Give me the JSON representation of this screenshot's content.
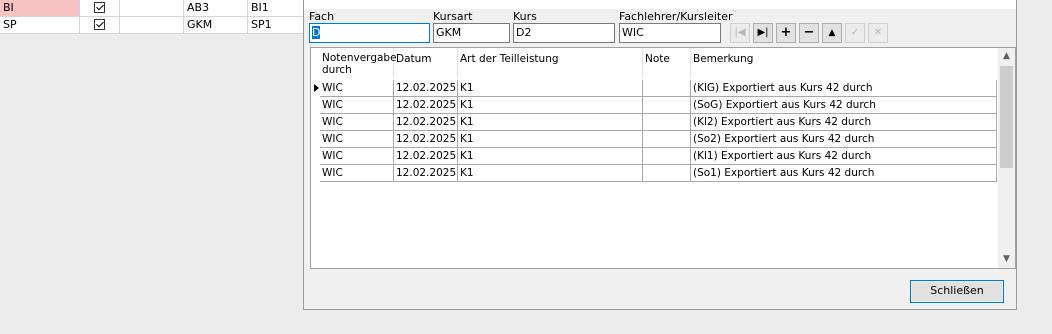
{
  "background_grid": {
    "rows": [
      {
        "fach": "BI",
        "checked": true,
        "col3": "",
        "kursart": "AB3",
        "kurs": "BI1"
      },
      {
        "fach": "SP",
        "checked": true,
        "col3": "",
        "kursart": "GKM",
        "kurs": "SP1"
      }
    ]
  },
  "filters": {
    "fach_label": "Fach",
    "fach_value": "D",
    "kursart_label": "Kursart",
    "kursart_value": "GKM",
    "kurs_label": "Kurs",
    "kurs_value": "D2",
    "lehrer_label": "Fachlehrer/Kursleiter",
    "lehrer_value": "WIC"
  },
  "navigator": {
    "first": "|◀",
    "last": "▶|",
    "add": "+",
    "remove": "−",
    "up": "▲",
    "save": "✓",
    "cancel": "✕"
  },
  "table": {
    "headers": {
      "notenvergabe_line1": "Notenvergabe",
      "notenvergabe_line2": "durch",
      "datum": "Datum",
      "art": "Art der Teilleistung",
      "note": "Note",
      "bemerkung": "Bemerkung"
    },
    "rows": [
      {
        "notenvergabe": "WIC",
        "datum": "12.02.2025",
        "art": "K1",
        "note": "",
        "bemerkung": "(KlG) Exportiert aus Kurs 42 durch"
      },
      {
        "notenvergabe": "WIC",
        "datum": "12.02.2025",
        "art": "K1",
        "note": "",
        "bemerkung": "(SoG) Exportiert aus Kurs 42 durch"
      },
      {
        "notenvergabe": "WIC",
        "datum": "12.02.2025",
        "art": "K1",
        "note": "",
        "bemerkung": "(Kl2) Exportiert aus Kurs 42 durch"
      },
      {
        "notenvergabe": "WIC",
        "datum": "12.02.2025",
        "art": "K1",
        "note": "",
        "bemerkung": "(So2) Exportiert aus Kurs 42 durch"
      },
      {
        "notenvergabe": "WIC",
        "datum": "12.02.2025",
        "art": "K1",
        "note": "",
        "bemerkung": "(Kl1) Exportiert aus Kurs 42 durch"
      },
      {
        "notenvergabe": "WIC",
        "datum": "12.02.2025",
        "art": "K1",
        "note": "",
        "bemerkung": "(So1) Exportiert aus Kurs 42 durch"
      }
    ]
  },
  "buttons": {
    "close": "Schließen"
  },
  "colors": {
    "accent": "#0078d7",
    "highlight_cell": "#f8c3c3"
  }
}
